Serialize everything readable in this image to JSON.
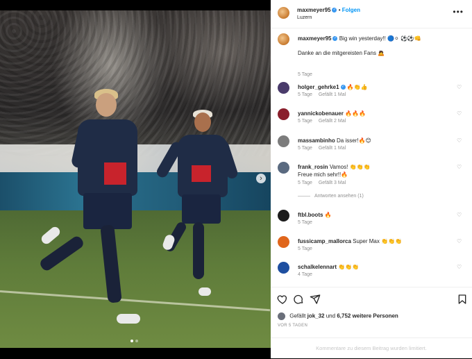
{
  "post": {
    "author": "maxmeyer95",
    "location": "Luzern",
    "follow_label": "Folgen",
    "more_label": "•••"
  },
  "media": {
    "next_label": "›",
    "slide_count": 2,
    "active_slide": 1,
    "photo_description_icons": [
      "player-left-icon",
      "player-right-icon"
    ]
  },
  "caption": {
    "user": "maxmeyer95",
    "text": "Big win yesterday!! 🔵⚪ ⚽⚽👊",
    "text2": "Danke an die mitgereisten Fans 🙇",
    "time": "5 Tage"
  },
  "comments": [
    {
      "user": "holger_gehrke1",
      "text": "🔥👏👍",
      "time": "5 Tage",
      "likes": "Gefällt 1 Mal",
      "avatar_color": "#4a3b6b"
    },
    {
      "user": "yannickobenauer",
      "text": "🔥🔥🔥",
      "time": "5 Tage",
      "likes": "Gefällt 2 Mal",
      "avatar_color": "#8a1f2c"
    },
    {
      "user": "massambinho",
      "text": "Da isser!🔥😊",
      "time": "5 Tage",
      "likes": "Gefällt 1 Mal",
      "avatar_color": "#7c7c7c"
    },
    {
      "user": "frank_rosin",
      "text": "Vamos! 👏👏👏",
      "text2": "Freue mich sehr!!🔥",
      "time": "5 Tage",
      "likes": "Gefällt 3 Mal",
      "avatar_color": "#5a6a80",
      "replies": "Antworten ansehen (1)"
    },
    {
      "user": "ftbl.boots",
      "text": "🔥",
      "time": "5 Tage",
      "likes": "",
      "avatar_color": "#1c1c1c"
    },
    {
      "user": "fussicamp_mallorca",
      "text": "Super Max 👏👏👏",
      "time": "5 Tage",
      "likes": "",
      "avatar_color": "#e0661c"
    },
    {
      "user": "schalkelennart",
      "text": "👏👏👏",
      "time": "4 Tage",
      "likes": "",
      "avatar_color": "#1e4fa0"
    }
  ],
  "actions": {
    "liked_by_prefix": "Gefällt",
    "liked_by_user": "jok_32",
    "liked_by_connector": "und",
    "liked_by_count": "6,752 weitere Personen",
    "timeago": "VOR 5 TAGEN"
  },
  "footer": {
    "limited_text": "Kommentare zu diesem Beitrag wurden limitiert."
  },
  "colors": {
    "accent": "#0095f6",
    "verified": "#3897f0",
    "muted": "#8e8e8e"
  }
}
